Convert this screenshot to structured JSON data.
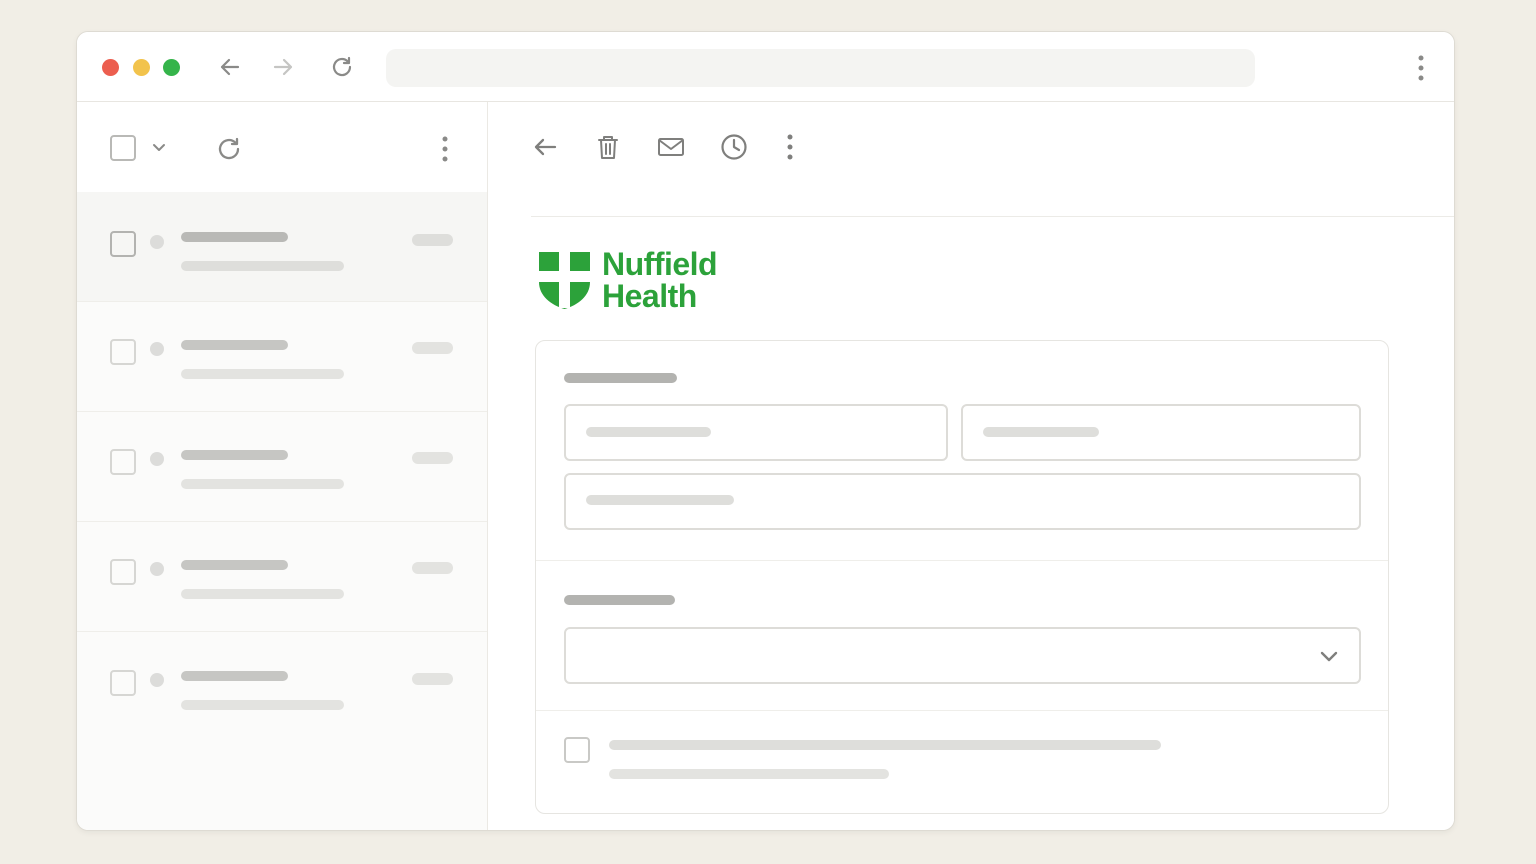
{
  "browser": {
    "traffic_lights": {
      "close": "#ec5e4f",
      "minimize": "#f2c34c",
      "maximize": "#35b44a"
    },
    "icons": [
      "back-arrow-icon",
      "forward-arrow-icon",
      "reload-icon",
      "kebab-menu-icon"
    ],
    "address": ""
  },
  "sidebar": {
    "toolbar_icons": [
      "select-all-checkbox",
      "chevron-down-icon",
      "refresh-icon",
      "kebab-menu-icon"
    ],
    "rows": [
      {
        "sender": "",
        "snippet": "",
        "time": ""
      },
      {
        "sender": "",
        "snippet": "",
        "time": ""
      },
      {
        "sender": "",
        "snippet": "",
        "time": ""
      },
      {
        "sender": "",
        "snippet": "",
        "time": ""
      },
      {
        "sender": "",
        "snippet": "",
        "time": ""
      }
    ]
  },
  "message": {
    "toolbar_icons": [
      "back-arrow-icon",
      "trash-icon",
      "mail-icon",
      "clock-icon",
      "kebab-menu-icon"
    ],
    "brand": {
      "line1": "Nuffield",
      "line2": "Health",
      "color": "#2ca23a"
    },
    "form": {
      "section1_title": "",
      "first_name": "",
      "last_name": "",
      "email": "",
      "section2_title": "",
      "select_value": "",
      "consent_text": ""
    }
  },
  "colors": {
    "placeholder_dark": "#b9b9b6",
    "placeholder_light": "#dededb",
    "border": "#dddcd8"
  }
}
